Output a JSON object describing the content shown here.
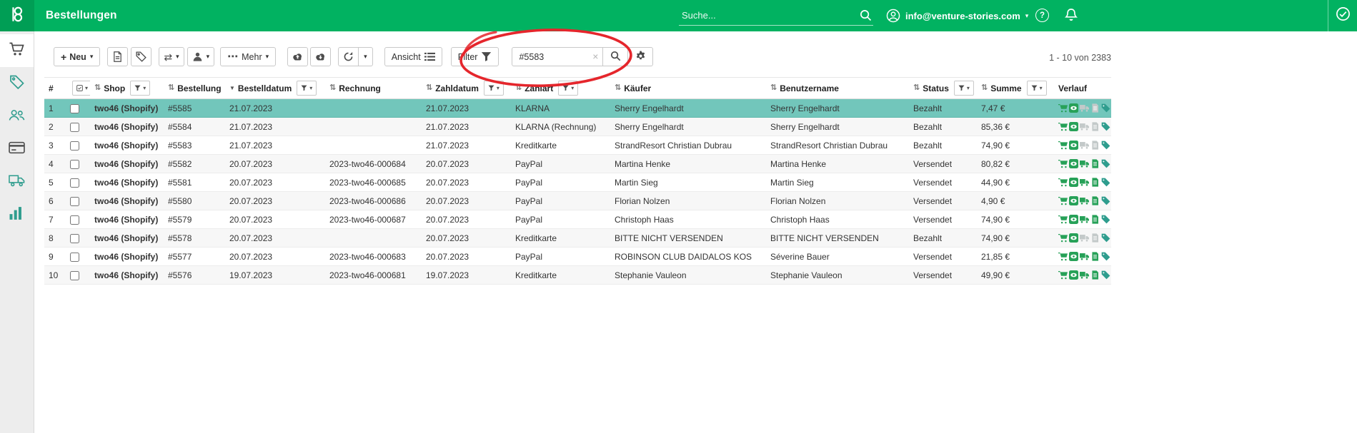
{
  "topbar": {
    "title": "Bestellungen",
    "search_placeholder": "Suche...",
    "account_email": "info@venture-stories.com"
  },
  "toolbar": {
    "neu_label": "Neu",
    "mehr_label": "Mehr",
    "ansicht_label": "Ansicht",
    "filter_label": "Filter",
    "order_search_value": "#5583",
    "pagination": "1 - 10 von 2383"
  },
  "icons": {
    "plus": "+",
    "caret": "▾",
    "ellipsis": "⋯",
    "swap": "⇄",
    "sort": "⇅",
    "sort_desc": "▼",
    "clear": "×",
    "help": "?"
  },
  "sidebar_icons": [
    "cart-icon",
    "tag-icon",
    "users-icon",
    "card-icon",
    "truck-icon",
    "chart-icon"
  ],
  "table": {
    "columns": [
      "#",
      "Shop",
      "Bestellung",
      "Bestelldatum",
      "Rechnung",
      "Zahldatum",
      "Zahlart",
      "Käufer",
      "Benutzername",
      "Status",
      "Summe",
      "Verlauf"
    ],
    "rows": [
      {
        "num": "1",
        "shop": "two46 (Shopify)",
        "order": "#5585",
        "order_date": "21.07.2023",
        "invoice": "",
        "pay_date": "21.07.2023",
        "pay_method": "KLARNA",
        "buyer": "Sherry Engelhardt",
        "username": "Sherry Engelhardt",
        "status": "Bezahlt",
        "sum": "7,47 €",
        "selected": true
      },
      {
        "num": "2",
        "shop": "two46 (Shopify)",
        "order": "#5584",
        "order_date": "21.07.2023",
        "invoice": "",
        "pay_date": "21.07.2023",
        "pay_method": "KLARNA (Rechnung)",
        "buyer": "Sherry Engelhardt",
        "username": "Sherry Engelhardt",
        "status": "Bezahlt",
        "sum": "85,36 €"
      },
      {
        "num": "3",
        "shop": "two46 (Shopify)",
        "order": "#5583",
        "order_date": "21.07.2023",
        "invoice": "",
        "pay_date": "21.07.2023",
        "pay_method": "Kreditkarte",
        "buyer": "StrandResort Christian Dubrau",
        "username": "StrandResort Christian Dubrau",
        "status": "Bezahlt",
        "sum": "74,90 €"
      },
      {
        "num": "4",
        "shop": "two46 (Shopify)",
        "order": "#5582",
        "order_date": "20.07.2023",
        "invoice": "2023-two46-000684",
        "pay_date": "20.07.2023",
        "pay_method": "PayPal",
        "buyer": "Martina Henke",
        "username": "Martina Henke",
        "status": "Versendet",
        "sum": "80,82 €"
      },
      {
        "num": "5",
        "shop": "two46 (Shopify)",
        "order": "#5581",
        "order_date": "20.07.2023",
        "invoice": "2023-two46-000685",
        "pay_date": "20.07.2023",
        "pay_method": "PayPal",
        "buyer": "Martin Sieg",
        "username": "Martin Sieg",
        "status": "Versendet",
        "sum": "44,90 €"
      },
      {
        "num": "6",
        "shop": "two46 (Shopify)",
        "order": "#5580",
        "order_date": "20.07.2023",
        "invoice": "2023-two46-000686",
        "pay_date": "20.07.2023",
        "pay_method": "PayPal",
        "buyer": "Florian Nolzen",
        "username": "Florian Nolzen",
        "status": "Versendet",
        "sum": "4,90 €"
      },
      {
        "num": "7",
        "shop": "two46 (Shopify)",
        "order": "#5579",
        "order_date": "20.07.2023",
        "invoice": "2023-two46-000687",
        "pay_date": "20.07.2023",
        "pay_method": "PayPal",
        "buyer": "Christoph Haas",
        "username": "Christoph Haas",
        "status": "Versendet",
        "sum": "74,90 €"
      },
      {
        "num": "8",
        "shop": "two46 (Shopify)",
        "order": "#5578",
        "order_date": "20.07.2023",
        "invoice": "",
        "pay_date": "20.07.2023",
        "pay_method": "Kreditkarte",
        "buyer": "BITTE NICHT VERSENDEN",
        "username": "BITTE NICHT VERSENDEN",
        "status": "Bezahlt",
        "sum": "74,90 €"
      },
      {
        "num": "9",
        "shop": "two46 (Shopify)",
        "order": "#5577",
        "order_date": "20.07.2023",
        "invoice": "2023-two46-000683",
        "pay_date": "20.07.2023",
        "pay_method": "PayPal",
        "buyer": "ROBINSON CLUB DAIDALOS KOS",
        "username": "Séverine Bauer",
        "status": "Versendet",
        "sum": "21,85 €"
      },
      {
        "num": "10",
        "shop": "two46 (Shopify)",
        "order": "#5576",
        "order_date": "19.07.2023",
        "invoice": "2023-two46-000681",
        "pay_date": "19.07.2023",
        "pay_method": "Kreditkarte",
        "buyer": "Stephanie Vauleon",
        "username": "Stephanie Vauleon",
        "status": "Versendet",
        "sum": "49,90 €"
      }
    ]
  },
  "colors": {
    "topbar_green": "#01b261",
    "logo_green": "#009e55",
    "selected_row": "#72c6bb",
    "annotation_red": "#e5262c",
    "icon_teal": "#2f9d8e",
    "icon_green": "#27a158",
    "icon_gray": "#c3c9c9"
  }
}
